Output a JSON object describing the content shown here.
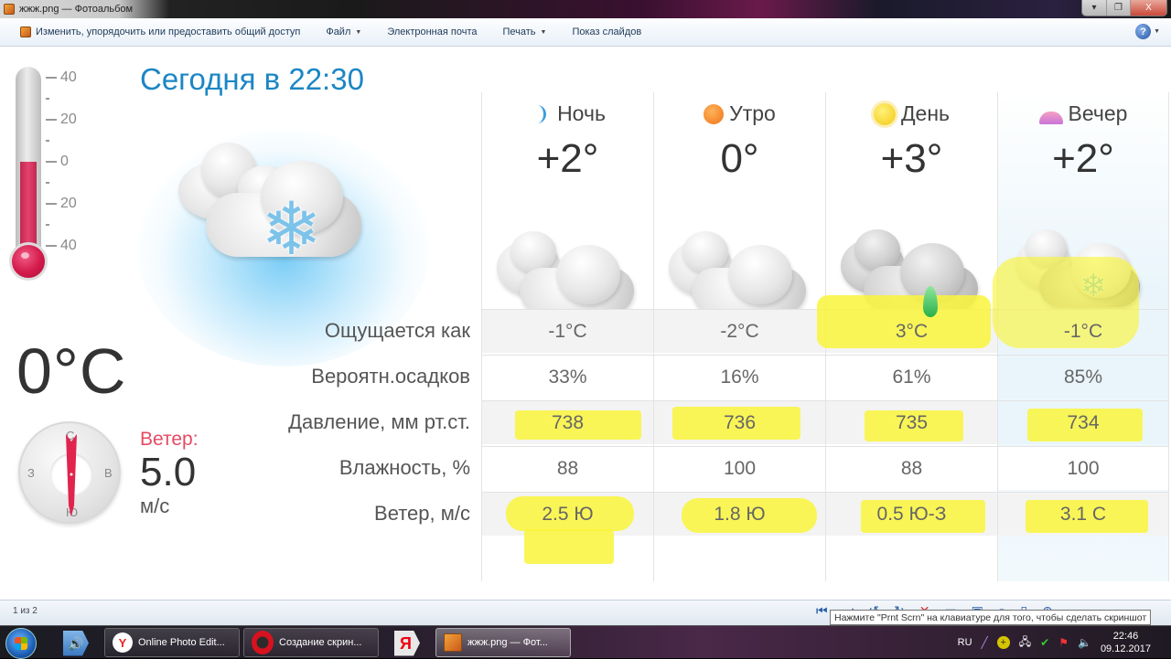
{
  "window": {
    "title": "жжж.png — Фотоальбом",
    "controls": [
      "▾",
      "❐",
      "X"
    ]
  },
  "toolbar": {
    "share_label": "Изменить, упорядочить или предоставить общий доступ",
    "file_label": "Файл",
    "email_label": "Электронная почта",
    "print_label": "Печать",
    "slideshow_label": "Показ слайдов",
    "help_glyph": "?"
  },
  "weather": {
    "today_title": "Сегодня в 22:30",
    "current_temp": "0°C",
    "thermometer": {
      "ticks": [
        "40",
        "20",
        "0",
        "20",
        "40"
      ],
      "level_fraction": 0.5
    },
    "wind": {
      "label": "Ветер:",
      "value": "5.0",
      "unit": "м/с",
      "compass": {
        "north": "С",
        "west": "З",
        "east": "В",
        "south": "Ю"
      }
    },
    "periods": [
      {
        "name": "Ночь",
        "icon": "moon-icon",
        "temp": "+2°",
        "condition": "cloudy"
      },
      {
        "name": "Утро",
        "icon": "morning-sun-icon",
        "temp": "0°",
        "condition": "cloudy"
      },
      {
        "name": "День",
        "icon": "sun-icon",
        "temp": "+3°",
        "condition": "cloudy-rain"
      },
      {
        "name": "Вечер",
        "icon": "sunset-icon",
        "temp": "+2°",
        "condition": "cloudy-snow"
      }
    ],
    "rows": [
      {
        "label": "Ощущается как",
        "values": [
          "-1°C",
          "-2°C",
          "3°C",
          "-1°C"
        ],
        "highlighted": false
      },
      {
        "label": "Вероятн.осадков",
        "values": [
          "33%",
          "16%",
          "61%",
          "85%"
        ],
        "highlighted": false
      },
      {
        "label": "Давление, мм рт.ст.",
        "values": [
          "738",
          "736",
          "735",
          "734"
        ],
        "highlighted": true
      },
      {
        "label": "Влажность, %",
        "values": [
          "88",
          "100",
          "88",
          "100"
        ],
        "highlighted": false
      },
      {
        "label": "Ветер, м/с",
        "values": [
          "2.5 Ю",
          "1.8 Ю",
          "0.5 Ю-З",
          "3.1 С"
        ],
        "highlighted": true
      }
    ],
    "highlight_color": "#f9f53a"
  },
  "statusbar": {
    "page_count": "1 из 2",
    "tooltip": "Нажмите \"Prnt Scrn\" на клавиатуре для того, чтобы сделать скриншот"
  },
  "taskbar": {
    "items": [
      {
        "label": "Online Photo Edit..."
      },
      {
        "label": "Создание скрин..."
      },
      {
        "label": "жжж.png — Фот..."
      }
    ],
    "language": "RU",
    "time": "22:46",
    "date": "09.12.2017"
  }
}
